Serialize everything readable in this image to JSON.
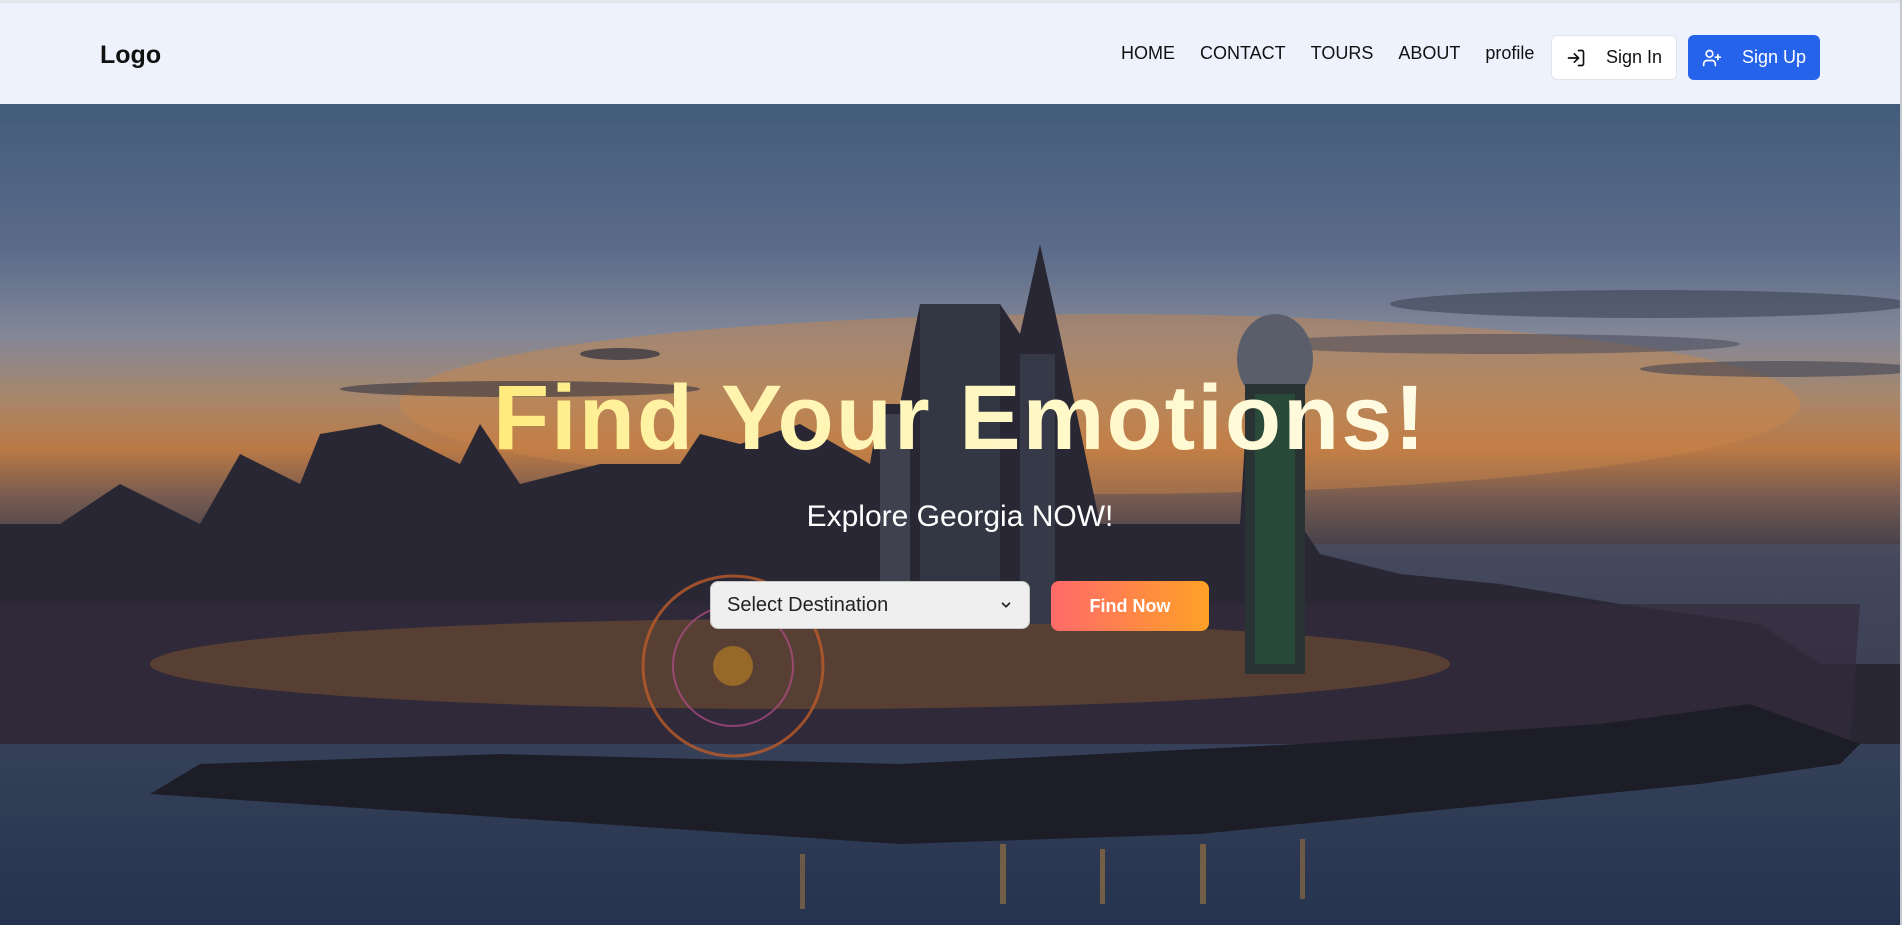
{
  "header": {
    "logo": "Logo",
    "nav": [
      "HOME",
      "CONTACT",
      "TOURS",
      "ABOUT",
      "profile"
    ],
    "signin_label": "Sign In",
    "signup_label": "Sign Up"
  },
  "hero": {
    "title": "Find Your Emotions!",
    "subtitle": "Explore Georgia NOW!",
    "select_value": "Select Destination",
    "find_label": "Find Now"
  },
  "colors": {
    "header_bg": "#eef2fd",
    "signup_bg": "#2563eb",
    "find_gradient_start": "#ff6a6a",
    "find_gradient_end": "#ffa126",
    "title_gradient_start": "#ffd200"
  },
  "icons": {
    "signin": "login-arrow-icon",
    "signup": "user-plus-icon",
    "select": "chevron-down-icon"
  }
}
